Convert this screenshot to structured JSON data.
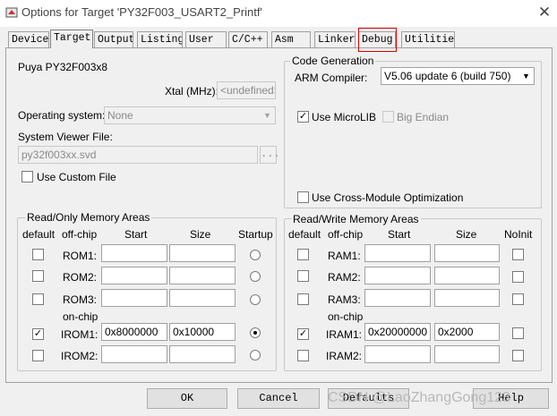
{
  "window": {
    "title": "Options for Target 'PY32F003_USART2_Printf'",
    "close_icon": "close-icon"
  },
  "tabs": [
    {
      "label": "Device"
    },
    {
      "label": "Target"
    },
    {
      "label": "Output"
    },
    {
      "label": "Listing"
    },
    {
      "label": "User"
    },
    {
      "label": "C/C++"
    },
    {
      "label": "Asm"
    },
    {
      "label": "Linker"
    },
    {
      "label": "Debug"
    },
    {
      "label": "Utilities"
    }
  ],
  "active_tab": "Target",
  "highlighted_tab": "Debug",
  "highlight_color": "#d40000",
  "target": {
    "device": "Puya PY32F003x8",
    "xtal_label": "Xtal (MHz):",
    "xtal_value": "<undefined>",
    "os_label": "Operating system:",
    "os_value": "None",
    "svf_label": "System Viewer File:",
    "svf_value": "py32f003xx.svd",
    "browse": "...",
    "custom_file_label": "Use Custom File"
  },
  "codegen": {
    "title": "Code Generation",
    "compiler_label": "ARM Compiler:",
    "compiler_value": "V5.06 update 6 (build 750)",
    "microlib_label": "Use MicroLIB",
    "microlib_checked": true,
    "bigendian_label": "Big Endian",
    "crossmodule_label": "Use Cross-Module Optimization"
  },
  "ro_memory": {
    "title": "Read/Only Memory Areas",
    "headers": {
      "default": "default",
      "offchip": "off-chip",
      "start": "Start",
      "size": "Size",
      "extra": "Startup"
    },
    "onchip_label": "on-chip",
    "rows": [
      {
        "name": "ROM1:",
        "start": "",
        "size": "",
        "default": false,
        "startup": false
      },
      {
        "name": "ROM2:",
        "start": "",
        "size": "",
        "default": false,
        "startup": false
      },
      {
        "name": "ROM3:",
        "start": "",
        "size": "",
        "default": false,
        "startup": false
      },
      {
        "name": "IROM1:",
        "start": "0x8000000",
        "size": "0x10000",
        "default": true,
        "startup": true
      },
      {
        "name": "IROM2:",
        "start": "",
        "size": "",
        "default": false,
        "startup": false
      }
    ]
  },
  "rw_memory": {
    "title": "Read/Write Memory Areas",
    "headers": {
      "default": "default",
      "offchip": "off-chip",
      "start": "Start",
      "size": "Size",
      "extra": "NoInit"
    },
    "onchip_label": "on-chip",
    "rows": [
      {
        "name": "RAM1:",
        "start": "",
        "size": "",
        "default": false,
        "noinit": false
      },
      {
        "name": "RAM2:",
        "start": "",
        "size": "",
        "default": false,
        "noinit": false
      },
      {
        "name": "RAM3:",
        "start": "",
        "size": "",
        "default": false,
        "noinit": false
      },
      {
        "name": "IRAM1:",
        "start": "0x20000000",
        "size": "0x2000",
        "default": true,
        "noinit": false
      },
      {
        "name": "IRAM2:",
        "start": "",
        "size": "",
        "default": false,
        "noinit": false
      }
    ]
  },
  "buttons": {
    "ok": "OK",
    "cancel": "Cancel",
    "defaults": "Defaults",
    "help": "Help"
  },
  "watermark": "CSDN @LaoZhangGong123"
}
